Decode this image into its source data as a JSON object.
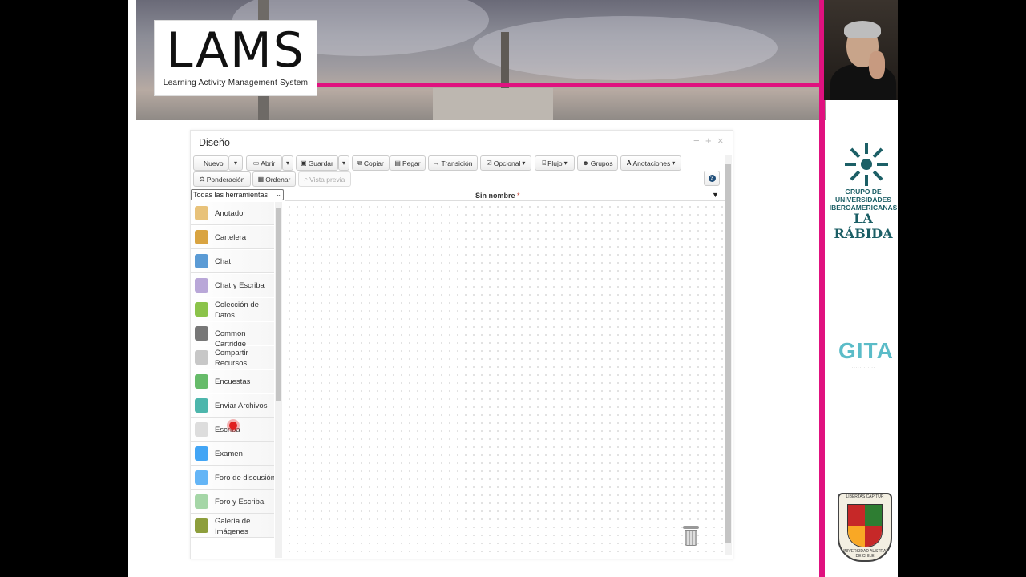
{
  "banner": {
    "logo_text": "LAMS",
    "logo_subtitle": "Learning Activity Management System"
  },
  "window": {
    "title": "Diseño"
  },
  "toolbar": {
    "new": "Nuevo",
    "open": "Abrir",
    "save": "Guardar",
    "copy": "Copiar",
    "paste": "Pegar",
    "transition": "Transición",
    "optional": "Opcional",
    "flow": "Flujo",
    "groups": "Grupos",
    "annotations": "Anotaciones",
    "weighting": "Ponderación",
    "arrange": "Ordenar",
    "preview": "Vista previa"
  },
  "tools_filter": {
    "selected": "Todas las herramientas"
  },
  "document": {
    "name": "Sin nombre",
    "modified_marker": "*"
  },
  "tools": [
    {
      "label": "Anotador",
      "icon": "notepad-icon",
      "color": "#e8c27a"
    },
    {
      "label": "Cartelera",
      "icon": "noticeboard-icon",
      "color": "#d9a441"
    },
    {
      "label": "Chat",
      "icon": "chat-bubble-icon",
      "color": "#5b9bd5"
    },
    {
      "label": "Chat y Escriba",
      "icon": "chat-scribe-icon",
      "color": "#b9a7d8"
    },
    {
      "label": "Colección de Datos",
      "icon": "database-icon",
      "color": "#8bc34a"
    },
    {
      "label": "Common Cartridge",
      "icon": "cartridge-icon",
      "color": "#777777"
    },
    {
      "label": "Compartir Recursos",
      "icon": "share-resources-icon",
      "color": "#c7c7c7"
    },
    {
      "label": "Encuestas",
      "icon": "survey-icon",
      "color": "#66bb6a"
    },
    {
      "label": "Enviar Archivos",
      "icon": "submit-files-icon",
      "color": "#4db6ac"
    },
    {
      "label": "Escriba",
      "icon": "scribe-icon",
      "color": "#dddddd"
    },
    {
      "label": "Examen",
      "icon": "assessment-icon",
      "color": "#42a5f5"
    },
    {
      "label": "Foro de discusión",
      "icon": "forum-icon",
      "color": "#64b5f6"
    },
    {
      "label": "Foro y Escriba",
      "icon": "forum-scribe-icon",
      "color": "#a5d6a7"
    },
    {
      "label": "Galería de Imágenes",
      "icon": "image-gallery-icon",
      "color": "#8d9e3c"
    }
  ],
  "sidebar_right": {
    "university_lines": "GRUPO DE UNIVERSIDADES IBEROAMERICANAS",
    "university_name": "LA RÁBIDA",
    "gita": "GITA",
    "seal_top": "LIBERTAS CAPITUR",
    "seal_bottom": "UNIVERSIDAD AUSTRAL DE CHILE"
  },
  "colors": {
    "accent_pink": "#e0117f",
    "brand_teal": "#1c5f66"
  }
}
